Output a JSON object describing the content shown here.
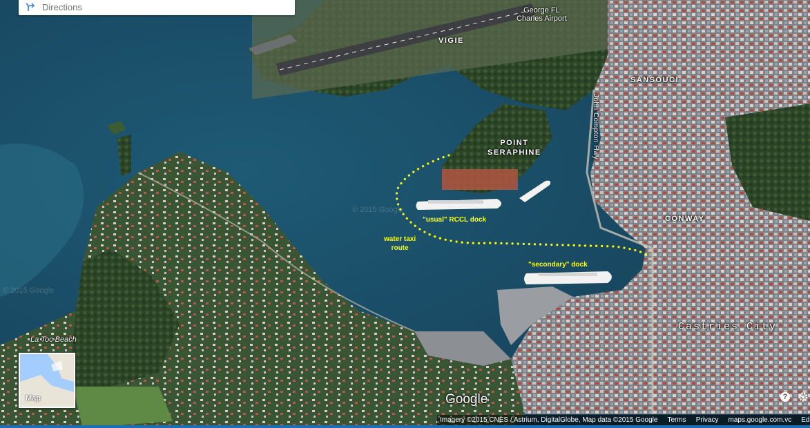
{
  "search": {
    "placeholder": "Directions",
    "icon": "directions-icon"
  },
  "labels": {
    "airport": "George FL\nCharles Airport",
    "vigie": "VIGIE",
    "sansouci": "SANSOUCI",
    "point_seraphine": "POINT\nSERAPHINE",
    "road": "John Compton Hwy",
    "conway": "CONWAY",
    "castries": "Castries City",
    "la_toc_beach": "La Toc Beach"
  },
  "annotations": {
    "usual_dock": "\"usual\" RCCL dock",
    "water_taxi": "water taxi\nroute",
    "secondary_dock": "\"secondary\" dock"
  },
  "watermarks": [
    "© 2015 Google",
    "© 2015 Google"
  ],
  "minimap": {
    "label": "Map"
  },
  "google_logo": "Google",
  "attribution": {
    "imagery": "Imagery ©2015 CNES / Astrium, DigitalGlobe, Map data ©2015 Google",
    "terms": "Terms",
    "privacy": "Privacy",
    "site": "maps.google.com.vc",
    "edit": "Ed"
  },
  "controls": {
    "help": "?",
    "settings_icon": "gear-icon"
  },
  "colors": {
    "annotation": "#ffff00",
    "sea_deep": "#1b4a63",
    "harbour": "#2b607c",
    "land": "#2f4a2a",
    "urban": "#8a8f95"
  }
}
